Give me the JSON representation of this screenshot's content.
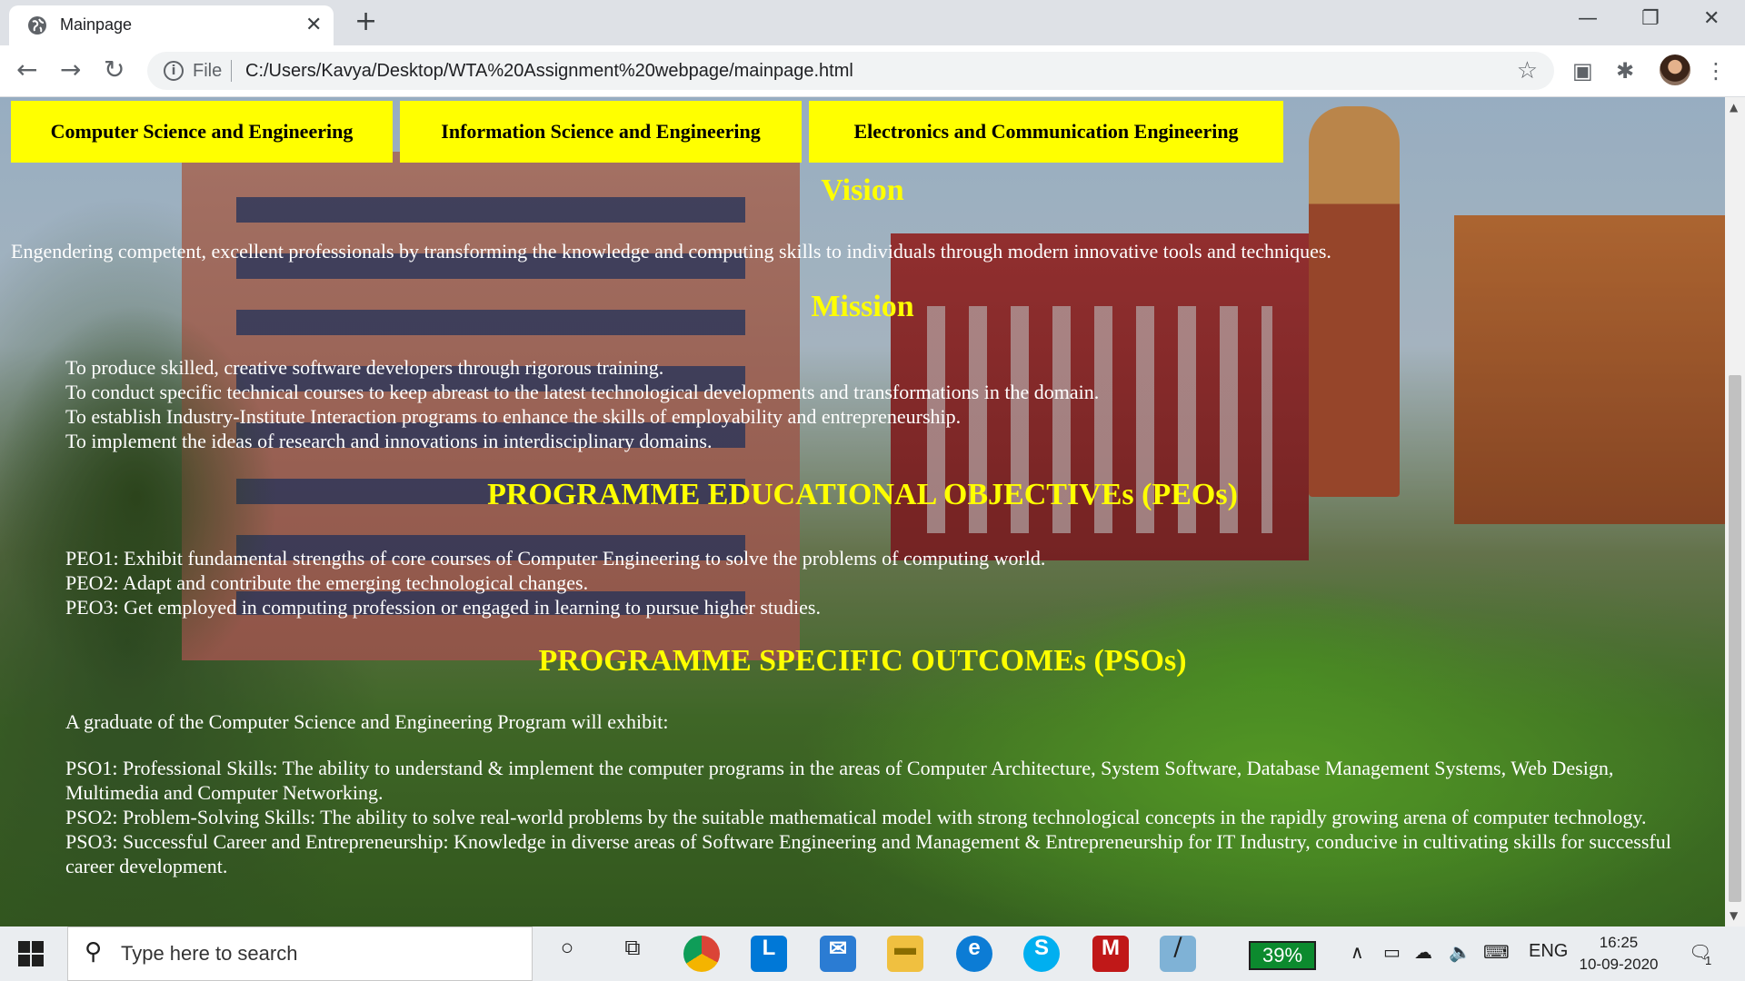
{
  "browser": {
    "tab_title": "Mainpage",
    "tab_close": "✕",
    "new_tab": "+",
    "scheme_label": "File",
    "url": "C:/Users/Kavya/Desktop/WTA%20Assignment%20webpage/mainpage.html"
  },
  "page": {
    "nav": [
      "Computer Science and Engineering",
      "Information Science and Engineering",
      "Electronics and Communication Engineering"
    ],
    "vision_heading": "Vision",
    "vision_text": "Engendering competent, excellent professionals by transforming the knowledge and computing skills to individuals through modern innovative tools and techniques.",
    "mission_heading": "Mission",
    "mission_items": [
      "To produce skilled, creative software developers through rigorous training.",
      "To conduct specific technical courses to keep abreast to the latest technological developments and transformations in the domain.",
      "To establish Industry-Institute Interaction programs to enhance the skills of employability and entrepreneurship.",
      "To implement the ideas of research and innovations in interdisciplinary domains."
    ],
    "peo_heading": "PROGRAMME EDUCATIONAL OBJECTIVEs (PEOs)",
    "peo_items": [
      "PEO1: Exhibit fundamental strengths of core courses of Computer Engineering to solve the problems of computing world.",
      "PEO2: Adapt and contribute the emerging technological changes.",
      "PEO3: Get employed in computing profession or engaged in learning to pursue higher studies."
    ],
    "pso_heading": "PROGRAMME SPECIFIC OUTCOMEs (PSOs)",
    "pso_intro": "A graduate of the Computer Science and Engineering Program will exhibit:",
    "pso_items": [
      "PSO1: Professional Skills: The ability to understand & implement the computer programs in the areas of Computer Architecture, System Software, Database Management Systems, Web Design, Multimedia and Computer Networking.",
      "PSO2: Problem-Solving Skills: The ability to solve real-world problems by the suitable mathematical model with strong technological concepts in the rapidly growing arena of computer technology.",
      "PSO3: Successful Career and Entrepreneurship: Knowledge in diverse areas of Software Engineering and Management & Entrepreneurship for IT Industry, conducive in cultivating skills for successful career development."
    ]
  },
  "taskbar": {
    "search_placeholder": "Type here to search",
    "battery": "39%",
    "language": "ENG",
    "time": "16:25",
    "date": "10-09-2020",
    "notification_count": "1"
  },
  "colors": {
    "accent_yellow": "#ffff00",
    "text_white": "#ffffff"
  }
}
